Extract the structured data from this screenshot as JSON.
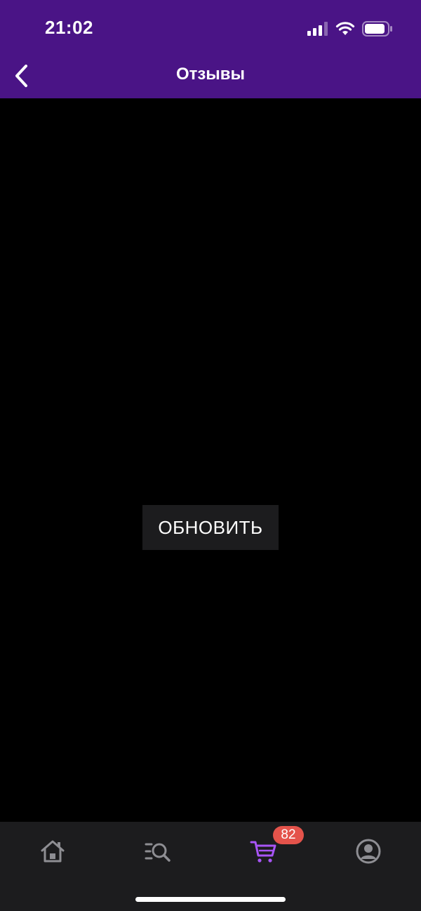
{
  "status_bar": {
    "time": "21:02",
    "icons": [
      "signal-icon",
      "wifi-icon",
      "battery-icon"
    ]
  },
  "nav": {
    "back_icon": "chevron-left-icon",
    "title": "Отзывы"
  },
  "content": {
    "refresh_label": "ОБНОВИТЬ"
  },
  "tab_bar": {
    "items": [
      {
        "icon": "home-icon"
      },
      {
        "icon": "catalog-search-icon"
      },
      {
        "icon": "cart-icon",
        "active": true
      },
      {
        "icon": "profile-icon"
      }
    ],
    "cart_badge": "82"
  },
  "colors": {
    "header_bg": "#4a1486",
    "content_bg": "#000000",
    "tab_bar_bg": "#1c1c1e",
    "button_bg": "#1c1c1e",
    "accent_active": "#a855f7",
    "icon_inactive": "#8e8e93",
    "badge_bg": "#e4534b"
  }
}
